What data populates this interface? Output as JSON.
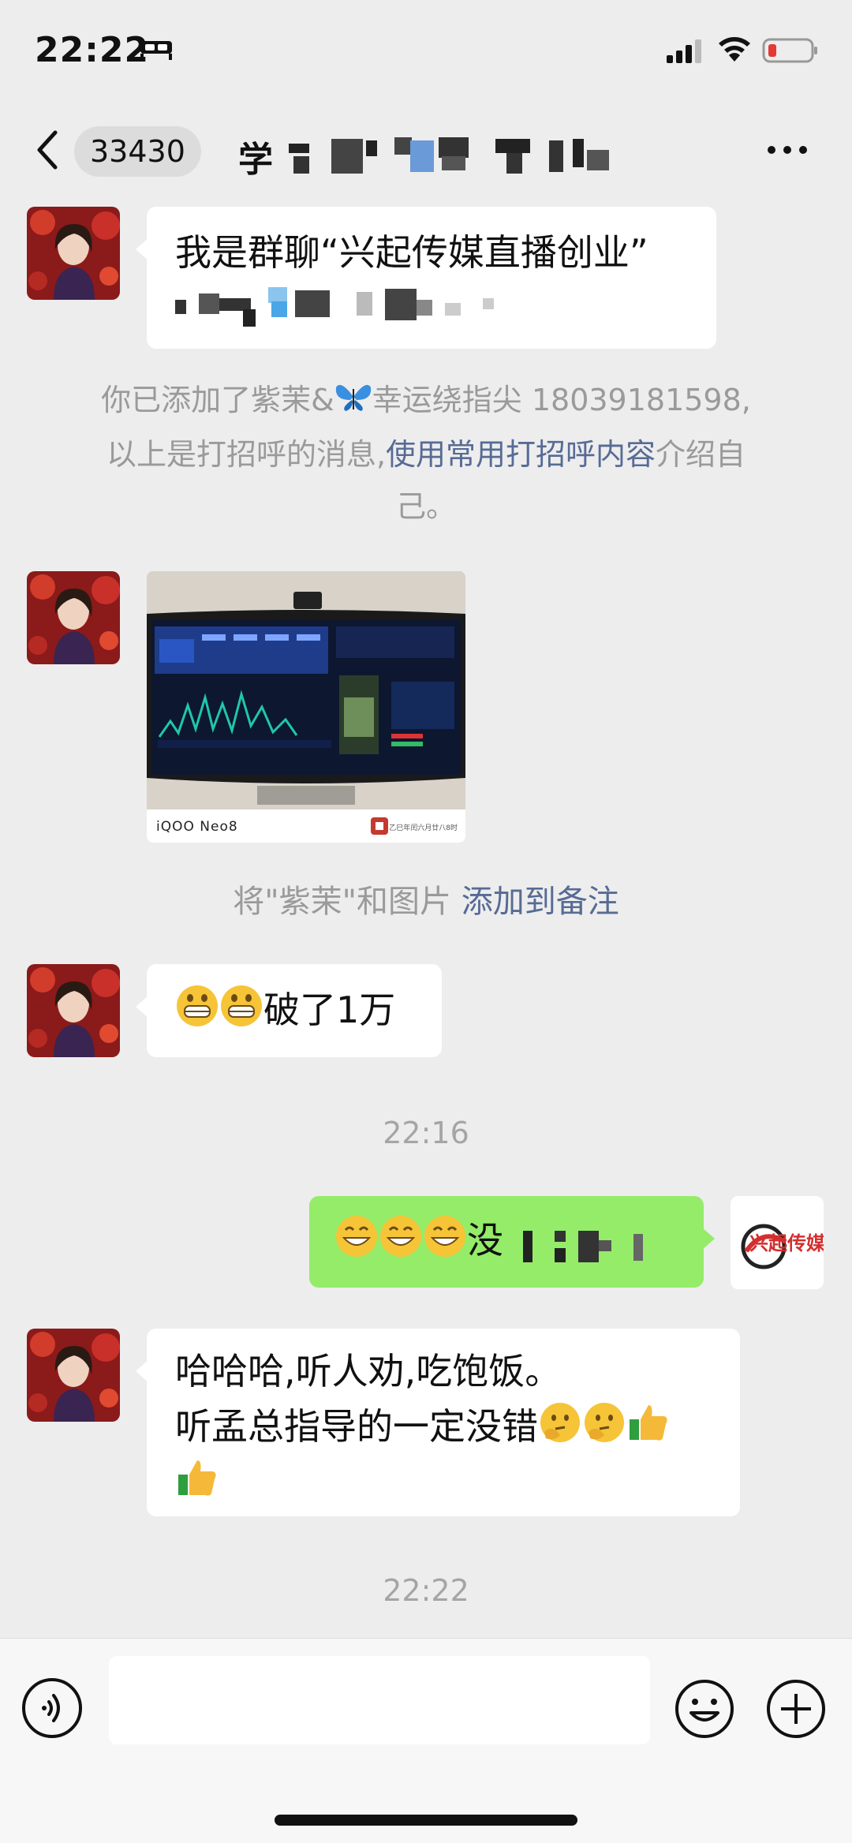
{
  "status": {
    "time": "22:22"
  },
  "nav": {
    "unread_count": "33430",
    "title_visible": "学"
  },
  "messages": {
    "m1_line1": "我是群聊“兴起传媒直播创业”",
    "sys_added_prefix": "你已添加了紫茉&",
    "sys_added_suffix": "幸运绕指尖 18039181598,",
    "sys_line2_prefix": "以上是打招呼的消息,",
    "sys_line2_link": "使用常用打招呼内容",
    "sys_line2_suffix": "介绍自",
    "sys_line3": "己。",
    "photo_brand": "iQOO Neo8",
    "photo_caption": "乙巳年闰六月廿八8时",
    "note_prefix": "将\"紫茉\"和图片",
    "note_link": "添加到备注",
    "m3_text": "破了1万",
    "ts1": "22:16",
    "me_text": "没",
    "me_avatar_text": "兴起传媒",
    "m4_line1": "哈哈哈,听人劝,吃饱饭。",
    "m4_line2": "听孟总指导的一定没错",
    "ts2": "22:22"
  },
  "colors": {
    "bubble_self": "#95ec69",
    "link": "#576b95",
    "background": "#ededed"
  }
}
